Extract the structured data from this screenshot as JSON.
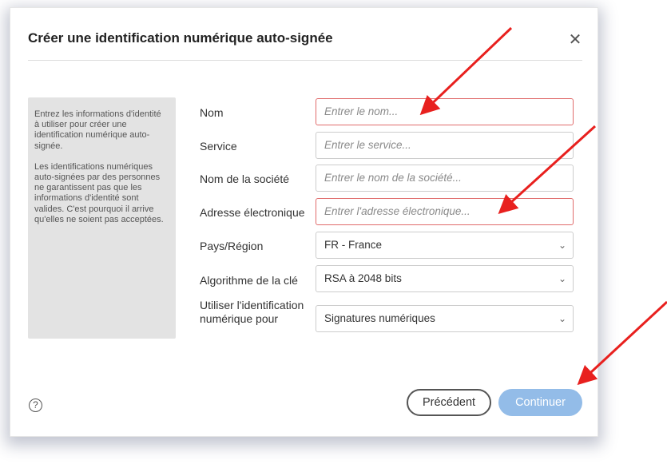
{
  "dialog": {
    "title": "Créer une identification numérique auto-signée",
    "close_icon": "close-icon",
    "info_paragraph_1": "Entrez les informations d'identité à utiliser pour créer une identification numérique auto-signée.",
    "info_paragraph_2": "Les identifications numériques auto-signées par des personnes ne garantissent pas que les informations d'identité sont valides. C'est pourquoi il arrive qu'elles ne soient pas acceptées."
  },
  "form": {
    "name": {
      "label": "Nom",
      "placeholder": "Entrer le nom..."
    },
    "service": {
      "label": "Service",
      "placeholder": "Entrer le service..."
    },
    "company": {
      "label": "Nom de la société",
      "placeholder": "Entrer le nom de la société..."
    },
    "email": {
      "label": "Adresse électronique",
      "placeholder": "Entrer l'adresse électronique..."
    },
    "country": {
      "label": "Pays/Région",
      "value": "FR - France"
    },
    "algorithm": {
      "label": "Algorithme de la clé",
      "value": "RSA à 2048 bits"
    },
    "usage": {
      "label_line1": "Utiliser l'identification",
      "label_line2": "numérique pour",
      "value": "Signatures numériques"
    }
  },
  "footer": {
    "help_icon": "help-icon",
    "help_glyph": "?",
    "prev_label": "Précédent",
    "next_label": "Continuer"
  },
  "colors": {
    "error_border": "#e06b6b",
    "primary_disabled": "#93bce8",
    "annotation_arrow": "#e8201e"
  }
}
